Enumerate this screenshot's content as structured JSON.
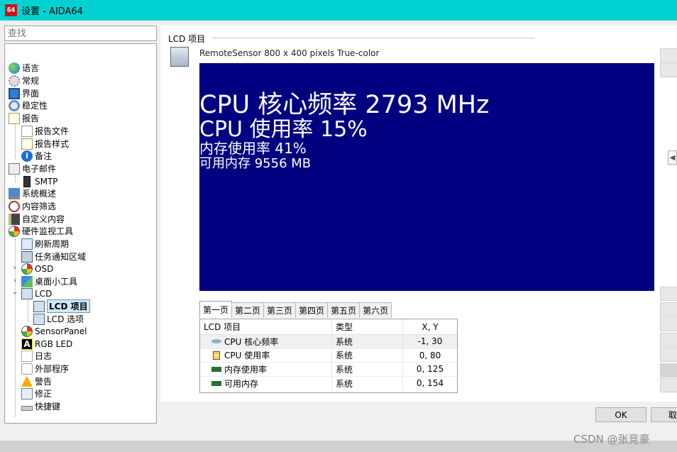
{
  "window": {
    "app_icon": "64",
    "title": "设置 - AIDA64"
  },
  "search": {
    "placeholder": "查找"
  },
  "tree": [
    {
      "label": "语言",
      "icon": "globe-icon"
    },
    {
      "label": "常规",
      "icon": "gear-icon"
    },
    {
      "label": "界面",
      "icon": "monitor-icon"
    },
    {
      "label": "稳定性",
      "icon": "magnify-icon"
    },
    {
      "label": "报告",
      "icon": "report-icon"
    },
    {
      "label": "报告文件",
      "icon": "file-icon"
    },
    {
      "label": "报告样式",
      "icon": "style-icon"
    },
    {
      "label": "备注",
      "icon": "info-icon"
    },
    {
      "label": "电子邮件",
      "icon": "mail-icon"
    },
    {
      "label": "SMTP",
      "icon": "server-icon"
    },
    {
      "label": "系统概述",
      "icon": "laptop-icon"
    },
    {
      "label": "内容筛选",
      "icon": "clock-icon"
    },
    {
      "label": "自定义内容",
      "icon": "book-icon"
    },
    {
      "label": "硬件监视工具",
      "icon": "gauge-icon"
    },
    {
      "label": "刷新周期",
      "icon": "refresh-icon"
    },
    {
      "label": "任务通知区域",
      "icon": "tray-icon"
    },
    {
      "label": "OSD",
      "icon": "gauge-icon"
    },
    {
      "label": "桌面小工具",
      "icon": "widget-icon"
    },
    {
      "label": "LCD",
      "icon": "lcd-icon"
    },
    {
      "label": "LCD 项目",
      "icon": "lcd-icon"
    },
    {
      "label": "LCD 选项",
      "icon": "lcd-icon"
    },
    {
      "label": "SensorPanel",
      "icon": "gauge-icon"
    },
    {
      "label": "RGB LED",
      "icon": "rgb-icon",
      "glyph": "A"
    },
    {
      "label": "日志",
      "icon": "log-icon"
    },
    {
      "label": "外部程序",
      "icon": "external-program-icon"
    },
    {
      "label": "警告",
      "icon": "warning-icon"
    },
    {
      "label": "修正",
      "icon": "fix-icon"
    },
    {
      "label": "快捷键",
      "icon": "hotkey-icon"
    }
  ],
  "main": {
    "section_title": "LCD 项目",
    "device_label": "RemoteSensor 800 x 400 pixels True-color",
    "lcd_lines": [
      "CPU 核心频率 2793 MHz",
      "CPU 使用率 15%",
      "内存使用率 41%",
      "可用内存 9556 MB"
    ],
    "lcd_bg": "#000080",
    "tabs": [
      "第一页",
      "第二页",
      "第三页",
      "第四页",
      "第五页",
      "第六页"
    ],
    "active_tab": "第一页",
    "grid": {
      "headers": [
        "LCD 项目",
        "类型",
        "X, Y"
      ],
      "rows": [
        {
          "name": "CPU 核心频率",
          "type": "系统",
          "xy": "-1, 30"
        },
        {
          "name": "CPU 使用率",
          "type": "系统",
          "xy": "0, 80"
        },
        {
          "name": "内存使用率",
          "type": "系统",
          "xy": "0, 125"
        },
        {
          "name": "可用内存",
          "type": "系统",
          "xy": "0, 154"
        }
      ]
    }
  },
  "buttons": {
    "ok": "OK",
    "cancel": "取消"
  },
  "watermark": "CSDN @张竞豪"
}
